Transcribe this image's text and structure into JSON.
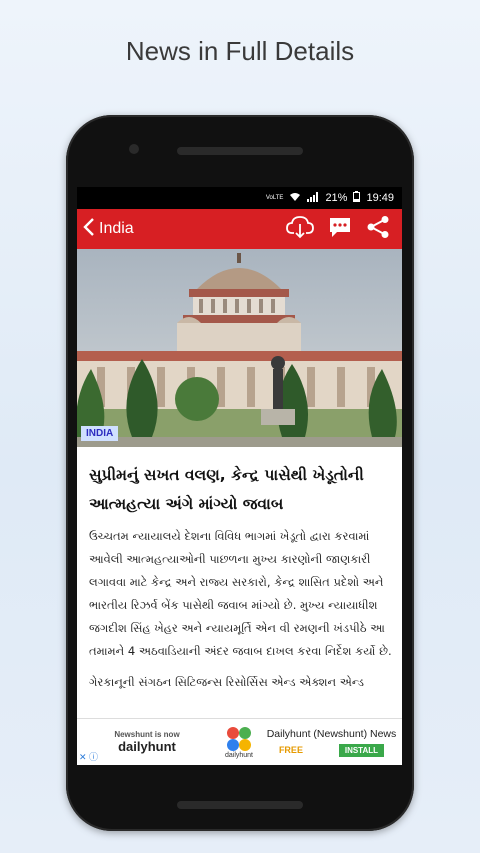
{
  "header": {
    "headline": "News in Full Details"
  },
  "status": {
    "network": "VoLTE",
    "battery": "21%",
    "time": "19:49"
  },
  "appbar": {
    "back_label": "India"
  },
  "article": {
    "category_badge": "INDIA",
    "title": "સુપ્રીમનું સખત વલણ, કેન્દ્ર પાસેથી ખેડૂતોની આત્મહત્યા અંગે માંગ્યો જવાબ",
    "paragraphs": [
      "ઉચ્ચતમ ન્યાયાલયે દેશના વિવિધ ભાગમાં ખેડૂતો દ્વારા કરવામાં આવેલી આત્મહત્યાઓની પાછળના મુખ્ય કારણોની જાણકારી લગાવવા માટે કેન્દ્ર અને રાજ્ય સરકારો, કેન્દ્ર શાસિત પ્રદેશો અને ભારતીય રિઝર્વ બેંક પાસેથી જવાબ માંગ્યો છે. મુખ્ય ન્યાયાધીશ જગદીશ સિંહ ખેહર અને ન્યાયમૂર્તિ એન વી રમણની ખંડપીઠે આ તમામને 4 અઠવાડિયાની અંદર જવાબ દાખલ કરવા નિર્દેશ કર્યો છે.",
      "ગેરકાનૂની સંગઠન સિટિજન્સ રિસોર્સિસ એન્ડ એક્શન એન્ડ"
    ]
  },
  "ad": {
    "brand_small": "Newshunt is now",
    "brand_big": "dailyhunt",
    "icon_caption": "dailyhunt",
    "app_name": "Dailyhunt (Newshunt) News",
    "price": "FREE",
    "install_label": "INSTALL"
  },
  "colors": {
    "appbar": "#d71f23",
    "badge_bg": "#cfe0ff",
    "install": "#3aa84a"
  }
}
